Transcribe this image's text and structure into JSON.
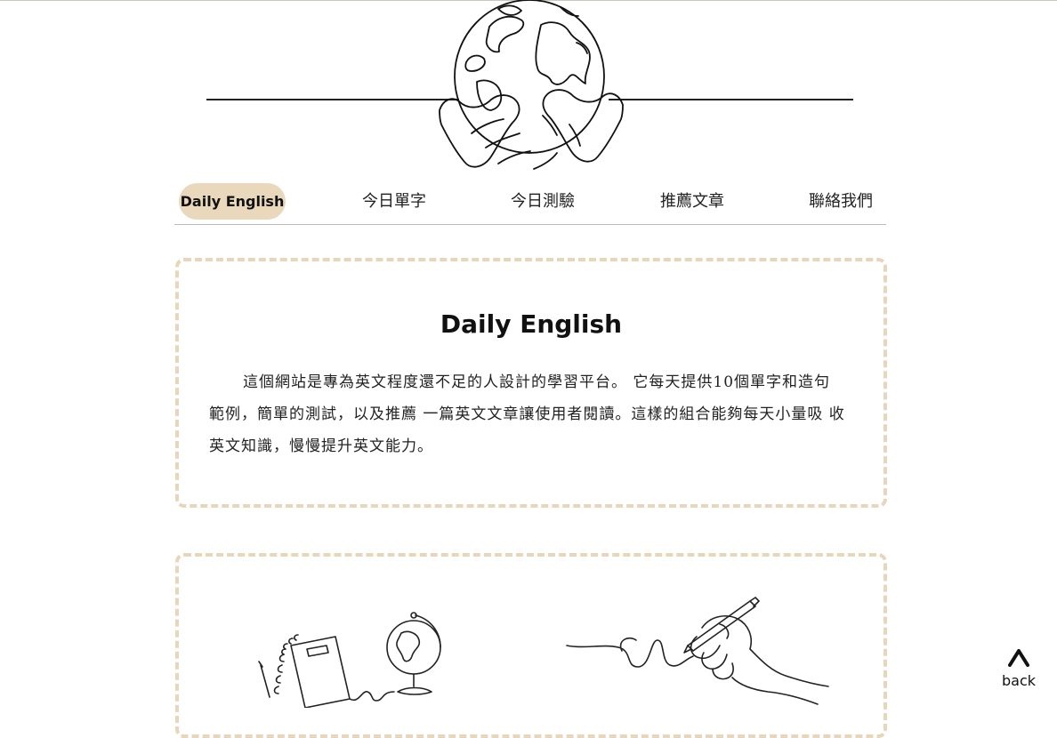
{
  "nav": {
    "logo": "Daily English",
    "items": [
      {
        "label": "今日單字"
      },
      {
        "label": "今日測驗"
      },
      {
        "label": "推薦文章"
      },
      {
        "label": "聯絡我們"
      }
    ]
  },
  "intro": {
    "title": "Daily English",
    "text": "這個網站是專為英文程度還不足的人設計的學習平台。 它每天提供10個單字和造句範例，簡單的測試，以及推薦 一篇英文文章讓使用者閱讀。這樣的組合能夠每天小量吸 收英文知識，慢慢提升英文能力。"
  },
  "back": {
    "label": "back",
    "icon": "caret-up-icon"
  },
  "icons": {
    "header": "globe-in-hands-icon",
    "card2_left": "notebook-and-globe-illustration",
    "card2_right": "hand-writing-illustration"
  },
  "colors": {
    "accent": "#e9d8bc",
    "card_border": "#e7d6b9",
    "text": "#222222"
  }
}
